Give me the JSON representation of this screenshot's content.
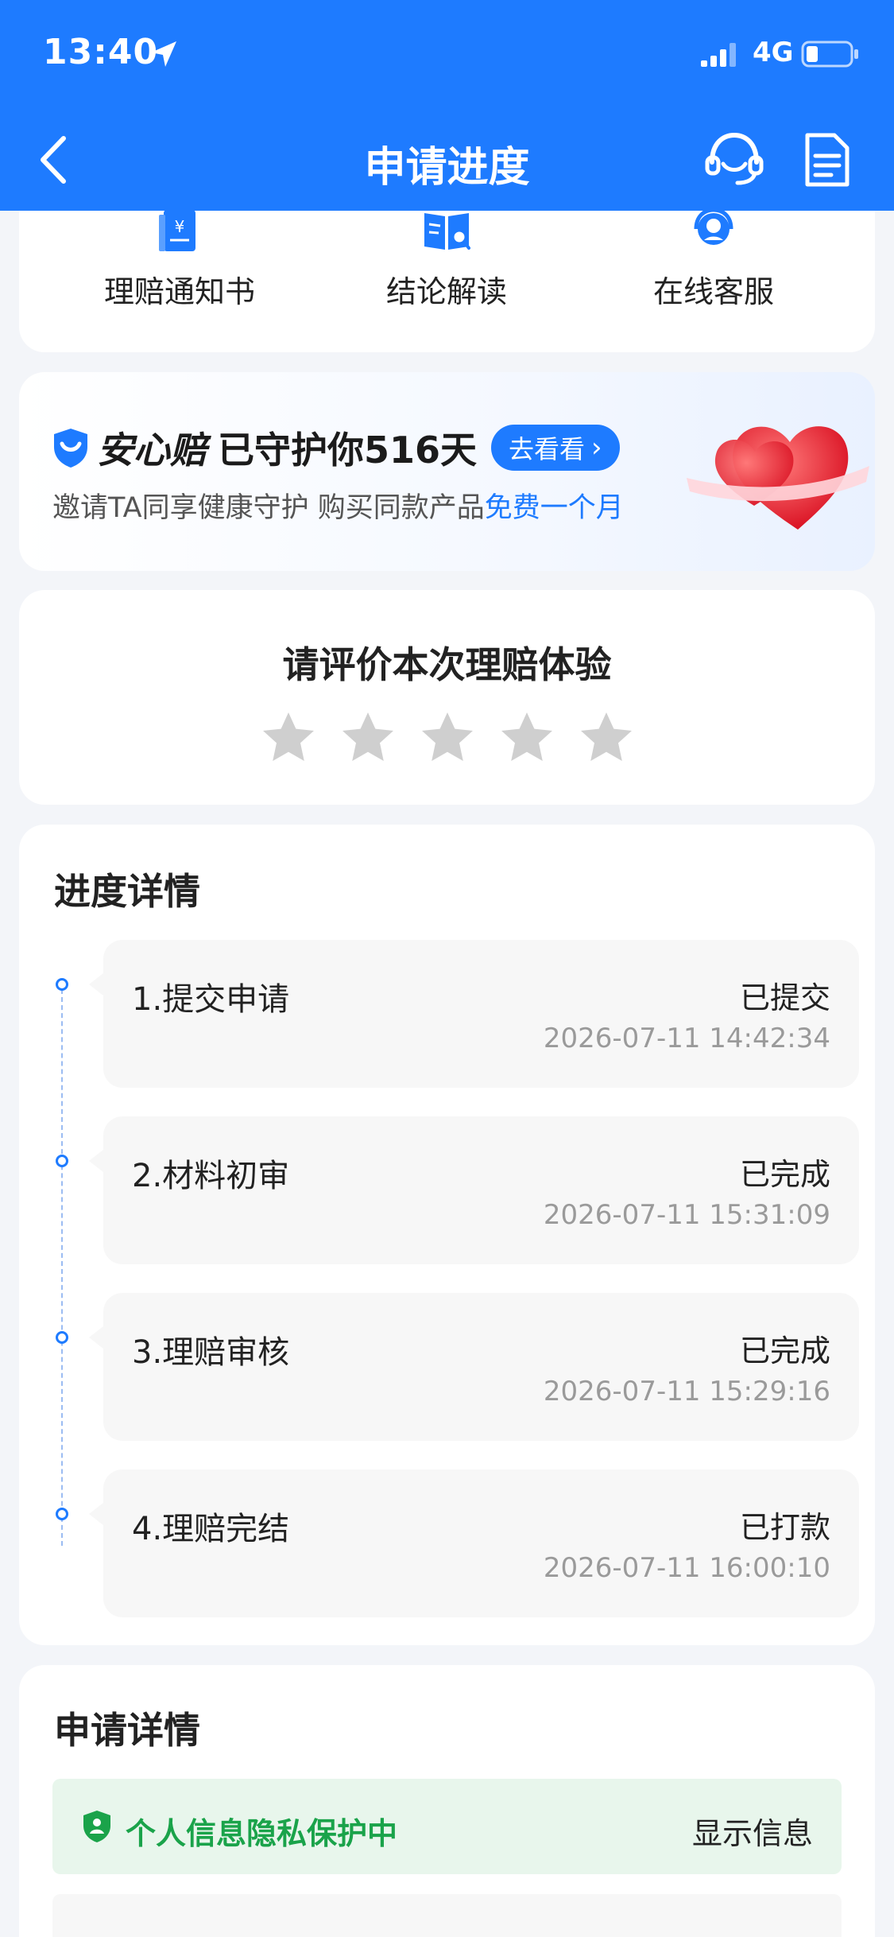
{
  "status_bar": {
    "time": "13:40",
    "network": "4G"
  },
  "nav": {
    "title": "申请进度"
  },
  "quick_links": [
    {
      "label": "理赔通知书",
      "icon": "claim-notice-icon"
    },
    {
      "label": "结论解读",
      "icon": "conclusion-icon"
    },
    {
      "label": "在线客服",
      "icon": "customer-service-icon"
    }
  ],
  "promo": {
    "brand": "安心赔",
    "guard_text": "已守护你516天",
    "button_label": "去看看",
    "subtitle_prefix": "邀请TA同享健康守护 购买同款产品",
    "subtitle_highlight": "免费一个月"
  },
  "rating": {
    "title": "请评价本次理赔体验",
    "max_stars": 5,
    "selected": 0
  },
  "progress": {
    "title": "进度详情",
    "steps": [
      {
        "name": "1.提交申请",
        "status": "已提交",
        "time": "2026-07-11 14:42:34"
      },
      {
        "name": "2.材料初审",
        "status": "已完成",
        "time": "2026-07-11 15:31:09"
      },
      {
        "name": "3.理赔审核",
        "status": "已完成",
        "time": "2026-07-11 15:29:16"
      },
      {
        "name": "4.理赔完结",
        "status": "已打款",
        "time": "2026-07-11 16:00:10"
      }
    ]
  },
  "details": {
    "title": "申请详情",
    "privacy_text": "个人信息隐私保护中",
    "show_info_label": "显示信息"
  },
  "colors": {
    "primary": "#1e7bff",
    "success": "#1aa34a",
    "star_inactive": "#cfcfcf"
  }
}
